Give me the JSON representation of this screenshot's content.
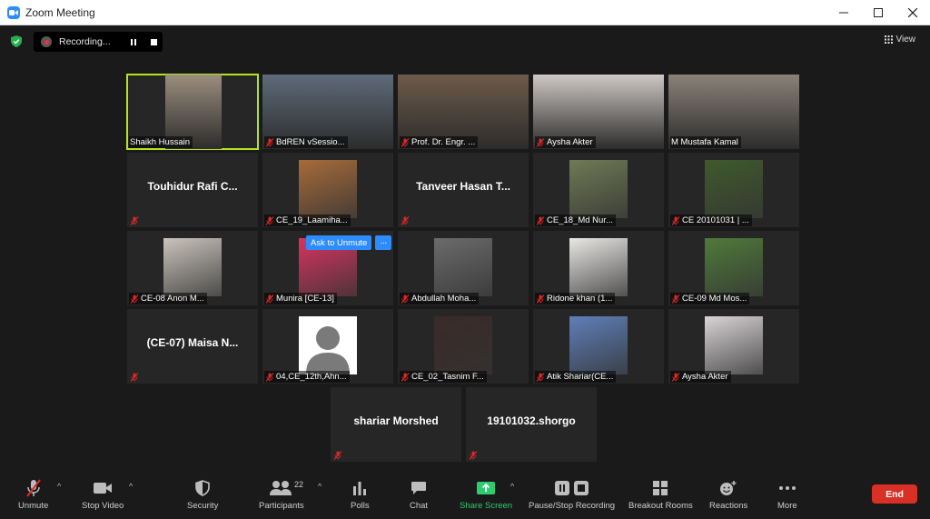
{
  "window": {
    "title": "Zoom Meeting"
  },
  "recording": {
    "status": "Recording..."
  },
  "view": {
    "label": "View"
  },
  "participants": [
    {
      "name": "Shaikh Hussain",
      "mode": "video",
      "bg": "#9b8e7e",
      "muted": false,
      "active": true
    },
    {
      "name": "BdREN vSessio...",
      "mode": "video",
      "bg": "#5e6b79",
      "muted": true
    },
    {
      "name": "Prof. Dr. Engr. ...",
      "mode": "video",
      "bg": "#6e5a4a",
      "muted": true
    },
    {
      "name": "Aysha Akter",
      "mode": "video",
      "bg": "#cfc8c4",
      "muted": true
    },
    {
      "name": "M Mustafa Kamal",
      "mode": "video",
      "bg": "#8a8278",
      "muted": false
    },
    {
      "name": "Touhidur Rafi C...",
      "mode": "name",
      "muted": true
    },
    {
      "name": "CE_19_Laamiha...",
      "mode": "photo",
      "bg": "#a66b3b",
      "muted": true
    },
    {
      "name": "Tanveer Hasan T...",
      "mode": "name",
      "muted": true
    },
    {
      "name": "CE_18_Md Nur...",
      "mode": "photo",
      "bg": "#6f7a55",
      "muted": true
    },
    {
      "name": "CE 20101031 | ...",
      "mode": "photo",
      "bg": "#3f5a2c",
      "muted": true
    },
    {
      "name": "CE-08 Anon M...",
      "mode": "photo",
      "bg": "#c9c3bb",
      "muted": true
    },
    {
      "name": "Munira [CE-13]",
      "mode": "photo",
      "bg": "#d8345f",
      "muted": true
    },
    {
      "name": "Abdullah Moha...",
      "mode": "photo",
      "bg": "#6b6b6b",
      "muted": true
    },
    {
      "name": "Ridone khan (1...",
      "mode": "photo",
      "bg": "#e9e7e4",
      "muted": true
    },
    {
      "name": "CE-09 Md Mos...",
      "mode": "photo",
      "bg": "#4f7a3a",
      "muted": true
    },
    {
      "name": "(CE-07) Maisa N...",
      "mode": "name",
      "muted": true
    },
    {
      "name": "04,CE_12th,Ahn...",
      "mode": "avatar",
      "muted": true
    },
    {
      "name": "CE_02_Tasnim F...",
      "mode": "photo",
      "bg": "#3a2a28",
      "muted": true
    },
    {
      "name": "Atik Shariar(CE...",
      "mode": "photo",
      "bg": "#5f7fb8",
      "muted": true
    },
    {
      "name": "Aysha Akter",
      "mode": "photo",
      "bg": "#d9d4d6",
      "muted": true
    },
    {
      "name": "shariar Morshed",
      "mode": "name",
      "muted": true
    },
    {
      "name": "19101032.shorgo",
      "mode": "name",
      "muted": true
    }
  ],
  "hover_menu": {
    "ask_label": "Ask to Unmute",
    "more_label": "···"
  },
  "toolbar": {
    "unmute": "Unmute",
    "stop_video": "Stop Video",
    "security": "Security",
    "participants": "Participants",
    "participant_count": "22",
    "polls": "Polls",
    "chat": "Chat",
    "share_screen": "Share Screen",
    "pause_stop_recording": "Pause/Stop Recording",
    "breakout_rooms": "Breakout Rooms",
    "reactions": "Reactions",
    "more": "More",
    "end": "End"
  },
  "colors": {
    "accent": "#2d8cff",
    "active_speaker": "#b5e61d",
    "share_green": "#2ecc71",
    "end_red": "#d93025",
    "muted_red": "#e02828"
  }
}
